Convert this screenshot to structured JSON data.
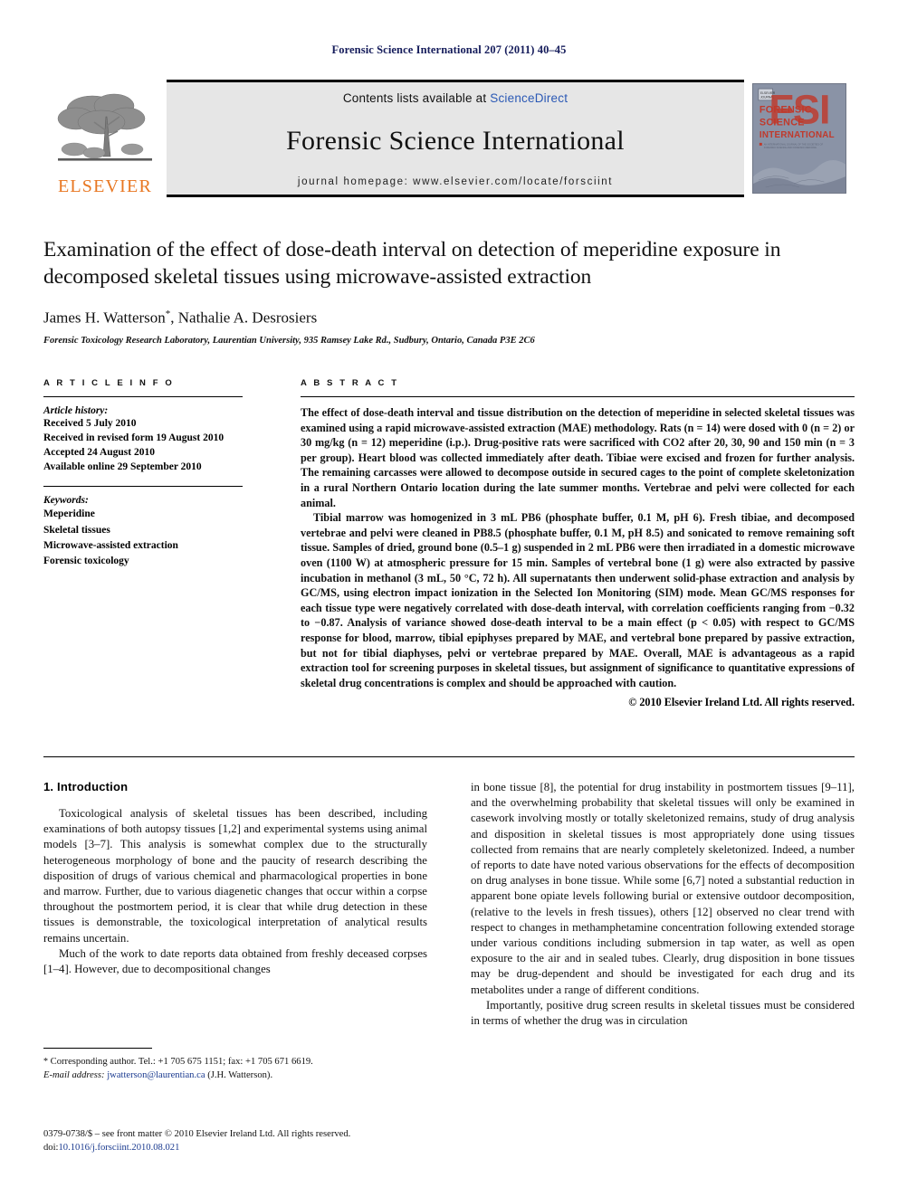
{
  "running_head": "Forensic Science International 207 (2011) 40–45",
  "masthead": {
    "publisher_name": "ELSEVIER",
    "contents_prefix": "Contents lists available at ",
    "sciencedirect": "ScienceDirect",
    "journal_name": "Forensic Science International",
    "homepage": "journal homepage: www.elsevier.com/locate/forsciint",
    "cover_title_lines": [
      "FORENSIC",
      "SCIENCE",
      "INTERNATIONAL"
    ],
    "cover_monogram": "FSI",
    "cover_accent_color": "#c0392b",
    "cover_bg_color": "#8a93a6",
    "brand_color": "#e87722",
    "link_color": "#2b59b5"
  },
  "article": {
    "title": "Examination of the effect of dose-death interval on detection of meperidine exposure in decomposed skeletal tissues using microwave-assisted extraction",
    "authors": "James H. Watterson",
    "authors_rest": ", Nathalie A. Desrosiers",
    "corresponding_marker": "*",
    "affiliation": "Forensic Toxicology Research Laboratory, Laurentian University, 935 Ramsey Lake Rd., Sudbury, Ontario, Canada P3E 2C6"
  },
  "article_info": {
    "label": "A R T I C L E   I N F O",
    "history_heading": "Article history:",
    "history": [
      "Received 5 July 2010",
      "Received in revised form 19 August 2010",
      "Accepted 24 August 2010",
      "Available online 29 September 2010"
    ],
    "keywords_heading": "Keywords:",
    "keywords": [
      "Meperidine",
      "Skeletal tissues",
      "Microwave-assisted extraction",
      "Forensic toxicology"
    ]
  },
  "abstract": {
    "label": "A B S T R A C T",
    "paragraphs": [
      "The effect of dose-death interval and tissue distribution on the detection of meperidine in selected skeletal tissues was examined using a rapid microwave-assisted extraction (MAE) methodology. Rats (n = 14) were dosed with 0 (n = 2) or 30 mg/kg (n = 12) meperidine (i.p.). Drug-positive rats were sacrificed with CO2 after 20, 30, 90 and 150 min (n = 3 per group). Heart blood was collected immediately after death. Tibiae were excised and frozen for further analysis. The remaining carcasses were allowed to decompose outside in secured cages to the point of complete skeletonization in a rural Northern Ontario location during the late summer months. Vertebrae and pelvi were collected for each animal.",
      "Tibial marrow was homogenized in 3 mL PB6 (phosphate buffer, 0.1 M, pH 6). Fresh tibiae, and decomposed vertebrae and pelvi were cleaned in PB8.5 (phosphate buffer, 0.1 M, pH 8.5) and sonicated to remove remaining soft tissue. Samples of dried, ground bone (0.5–1 g) suspended in 2 mL PB6 were then irradiated in a domestic microwave oven (1100 W) at atmospheric pressure for 15 min. Samples of vertebral bone (1 g) were also extracted by passive incubation in methanol (3 mL, 50 °C, 72 h). All supernatants then underwent solid-phase extraction and analysis by GC/MS, using electron impact ionization in the Selected Ion Monitoring (SIM) mode. Mean GC/MS responses for each tissue type were negatively correlated with dose-death interval, with correlation coefficients ranging from −0.32 to −0.87. Analysis of variance showed dose-death interval to be a main effect (p < 0.05) with respect to GC/MS response for blood, marrow, tibial epiphyses prepared by MAE, and vertebral bone prepared by passive extraction, but not for tibial diaphyses, pelvi or vertebrae prepared by MAE. Overall, MAE is advantageous as a rapid extraction tool for screening purposes in skeletal tissues, but assignment of significance to quantitative expressions of skeletal drug concentrations is complex and should be approached with caution."
    ],
    "copyright": "© 2010 Elsevier Ireland Ltd. All rights reserved."
  },
  "introduction": {
    "heading": "1. Introduction",
    "left_paragraphs": [
      "Toxicological analysis of skeletal tissues has been described, including examinations of both autopsy tissues [1,2] and experimental systems using animal models [3–7]. This analysis is somewhat complex due to the structurally heterogeneous morphology of bone and the paucity of research describing the disposition of drugs of various chemical and pharmacological properties in bone and marrow. Further, due to various diagenetic changes that occur within a corpse throughout the postmortem period, it is clear that while drug detection in these tissues is demonstrable, the toxicological interpretation of analytical results remains uncertain.",
      "Much of the work to date reports data obtained from freshly deceased corpses [1–4]. However, due to decompositional changes"
    ],
    "right_paragraphs": [
      "in bone tissue [8], the potential for drug instability in postmortem tissues [9–11], and the overwhelming probability that skeletal tissues will only be examined in casework involving mostly or totally skeletonized remains, study of drug analysis and disposition in skeletal tissues is most appropriately done using tissues collected from remains that are nearly completely skeletonized. Indeed, a number of reports to date have noted various observations for the effects of decomposition on drug analyses in bone tissue. While some [6,7] noted a substantial reduction in apparent bone opiate levels following burial or extensive outdoor decomposition, (relative to the levels in fresh tissues), others [12] observed no clear trend with respect to changes in methamphetamine concentration following extended storage under various conditions including submersion in tap water, as well as open exposure to the air and in sealed tubes. Clearly, drug disposition in bone tissues may be drug-dependent and should be investigated for each drug and its metabolites under a range of different conditions.",
      "Importantly, positive drug screen results in skeletal tissues must be considered in terms of whether the drug was in circulation"
    ]
  },
  "footnotes": {
    "corresponding_marker": "*",
    "corresponding": "Corresponding author. Tel.: +1 705 675 1151; fax: +1 705 671 6619.",
    "email_label": "E-mail address:",
    "email": "jwatterson@laurentian.ca",
    "email_owner": "(J.H. Watterson)."
  },
  "imprint": {
    "line1": "0379-0738/$ – see front matter © 2010 Elsevier Ireland Ltd. All rights reserved.",
    "doi_label": "doi:",
    "doi": "10.1016/j.forsciint.2010.08.021"
  }
}
